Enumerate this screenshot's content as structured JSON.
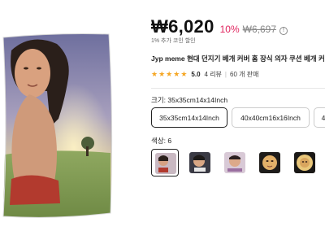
{
  "product": {
    "image_icon": "pillow-photo"
  },
  "price": {
    "current": "₩6,020",
    "discount": "10%",
    "original": "₩6,697",
    "info_icon": "!"
  },
  "coupon_note": "1% 추가 코인 할인",
  "title": "Jyp meme 현대 던지기 베개 커버 홈 장식 의자 쿠션 베개 커",
  "rating": {
    "value": "5.0",
    "reviews": "4 리뷰",
    "separator": "|",
    "sold": "60 개 판매",
    "star_color": "#f5a623",
    "stars": 5
  },
  "size": {
    "label": "크기: 35x35cm14x14Inch",
    "options": [
      "35x35cm14x14Inch",
      "40x40cm16x16Inch",
      "4"
    ],
    "selected_index": 0
  },
  "color": {
    "label": "색상: 6",
    "swatch_count": 5,
    "selected_index": 0
  }
}
